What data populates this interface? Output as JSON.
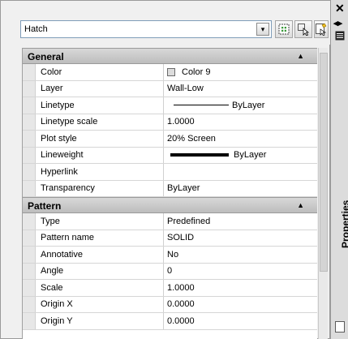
{
  "toolbar": {
    "object_type": "Hatch"
  },
  "sections": [
    {
      "label": "General",
      "rows": [
        {
          "name": "Color",
          "value": "Color 9"
        },
        {
          "name": "Layer",
          "value": "Wall-Low"
        },
        {
          "name": "Linetype",
          "value": "ByLayer"
        },
        {
          "name": "Linetype scale",
          "value": "1.0000"
        },
        {
          "name": "Plot style",
          "value": "20% Screen"
        },
        {
          "name": "Lineweight",
          "value": "ByLayer"
        },
        {
          "name": "Hyperlink",
          "value": ""
        },
        {
          "name": "Transparency",
          "value": "ByLayer"
        }
      ]
    },
    {
      "label": "Pattern",
      "rows": [
        {
          "name": "Type",
          "value": "Predefined"
        },
        {
          "name": "Pattern name",
          "value": "SOLID"
        },
        {
          "name": "Annotative",
          "value": "No"
        },
        {
          "name": "Angle",
          "value": "0"
        },
        {
          "name": "Scale",
          "value": "1.0000"
        },
        {
          "name": "Origin X",
          "value": "0.0000"
        },
        {
          "name": "Origin Y",
          "value": "0.0000"
        }
      ]
    }
  ],
  "sidebar": {
    "title": "Properties"
  },
  "icons": {
    "close": "close-icon",
    "autohide": "autohide-icon",
    "properties_menu": "properties-menu-icon",
    "toggle_pickadd": "toggle-pickadd-icon",
    "select_objects": "select-objects-icon",
    "quick_select": "quick-select-icon"
  }
}
